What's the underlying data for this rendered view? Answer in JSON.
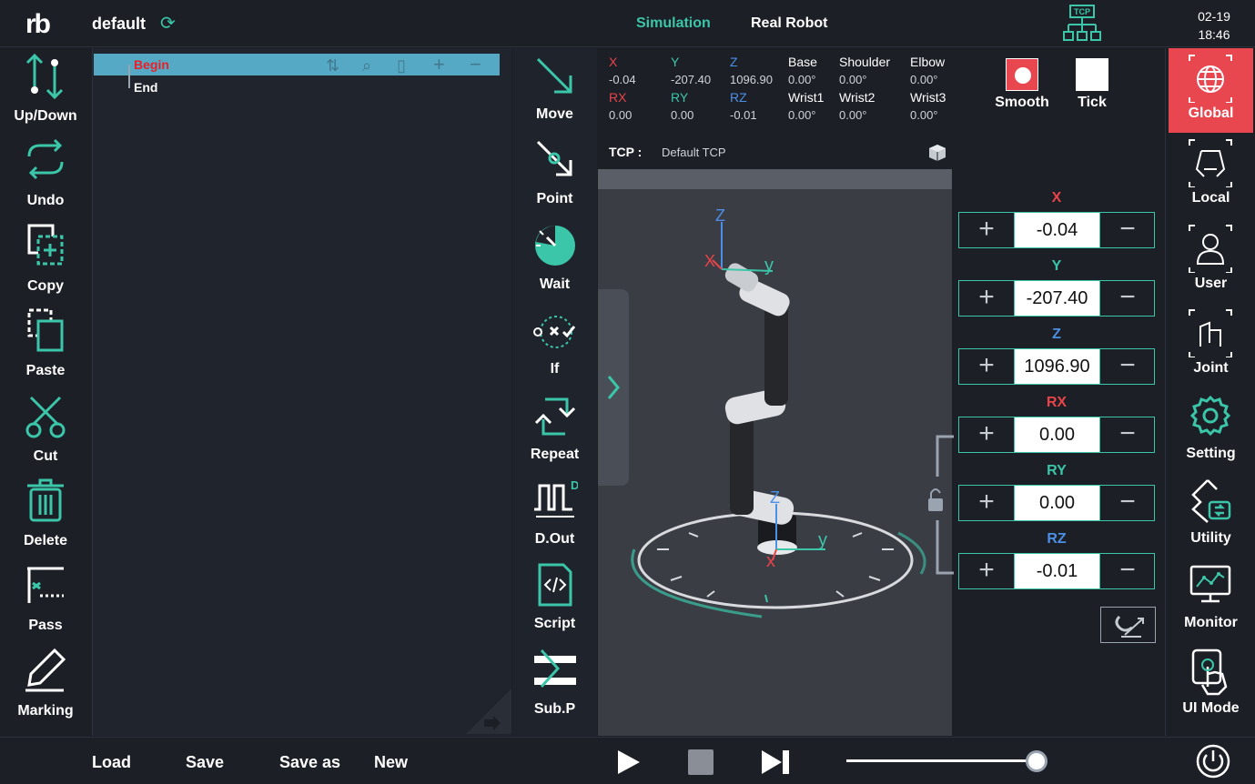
{
  "app": {
    "logo": "rb",
    "project_name": "default",
    "date": "02-19",
    "time": "18:46"
  },
  "top_tabs": {
    "simulation": "Simulation",
    "real_robot": "Real Robot",
    "tcp_icon_label": "TCP"
  },
  "left_tools": [
    "Up/Down",
    "Undo",
    "Copy",
    "Paste",
    "Cut",
    "Delete",
    "Pass",
    "Marking"
  ],
  "tree": {
    "begin": "Begin",
    "end": "End"
  },
  "commands": [
    "Move",
    "Point",
    "Wait",
    "If",
    "Repeat",
    "D.Out",
    "Script",
    "Sub.P"
  ],
  "readout": {
    "cartesian": [
      {
        "key": "X",
        "value": "-0.04",
        "color": "#e8444a"
      },
      {
        "key": "Y",
        "value": "-207.40",
        "color": "#3bc6a9"
      },
      {
        "key": "Z",
        "value": "1096.90",
        "color": "#4c8fe6"
      },
      {
        "key": "RX",
        "value": "0.00",
        "color": "#e8444a"
      },
      {
        "key": "RY",
        "value": "0.00",
        "color": "#3bc6a9"
      },
      {
        "key": "RZ",
        "value": "-0.01",
        "color": "#4c8fe6"
      }
    ],
    "joints": [
      {
        "key": "Base",
        "value": "0.00°"
      },
      {
        "key": "Shoulder",
        "value": "0.00°"
      },
      {
        "key": "Elbow",
        "value": "0.00°"
      },
      {
        "key": "Wrist1",
        "value": "0.00°"
      },
      {
        "key": "Wrist2",
        "value": "0.00°"
      },
      {
        "key": "Wrist3",
        "value": "0.00°"
      }
    ],
    "tcp_label": "TCP :",
    "tcp_value": "Default TCP"
  },
  "motion_mode": {
    "smooth": "Smooth",
    "tick": "Tick",
    "selected": "Smooth"
  },
  "viewport_axes": {
    "z": "Z",
    "x": "X",
    "y": "y",
    "z2": "Z",
    "y2": "y",
    "x2": "x"
  },
  "jog": [
    {
      "axis": "X",
      "value": "-0.04",
      "color": "#e8444a"
    },
    {
      "axis": "Y",
      "value": "-207.40",
      "color": "#3bc6a9"
    },
    {
      "axis": "Z",
      "value": "1096.90",
      "color": "#4c8fe6"
    },
    {
      "axis": "RX",
      "value": "0.00",
      "color": "#e8444a"
    },
    {
      "axis": "RY",
      "value": "0.00",
      "color": "#3bc6a9"
    },
    {
      "axis": "RZ",
      "value": "-0.01",
      "color": "#4c8fe6"
    }
  ],
  "jog_symbols": {
    "plus": "+",
    "minus": "−"
  },
  "right_tools": [
    "Global",
    "Local",
    "User",
    "Joint",
    "Setting",
    "Utility",
    "Monitor",
    "UI Mode"
  ],
  "right_tools_active": "Global",
  "bottom": {
    "load": "Load",
    "save": "Save",
    "save_as": "Save as",
    "new": "New",
    "speed": 0.93
  },
  "colors": {
    "accent": "#3bc6a9",
    "active": "#e9474f",
    "x": "#e8444a",
    "y": "#3bc6a9",
    "z": "#4c8fe6"
  }
}
